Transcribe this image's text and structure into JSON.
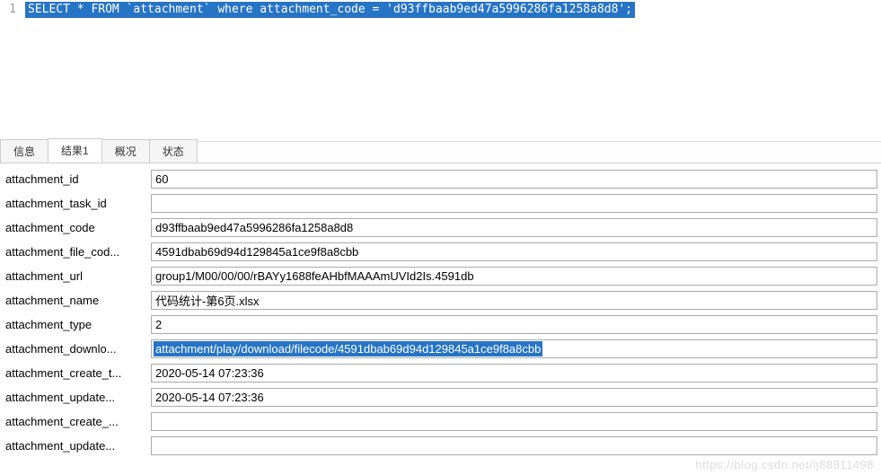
{
  "editor": {
    "line_number": "1",
    "sql": "SELECT * FROM `attachment` where attachment_code = 'd93ffbaab9ed47a5996286fa1258a8d8';"
  },
  "tabs": {
    "items": [
      {
        "label": "信息"
      },
      {
        "label": "结果1"
      },
      {
        "label": "概况"
      },
      {
        "label": "状态"
      }
    ],
    "active_index": 1
  },
  "rows": [
    {
      "label": "attachment_id",
      "value": "60",
      "selected": false
    },
    {
      "label": "attachment_task_id",
      "value": "",
      "selected": false
    },
    {
      "label": "attachment_code",
      "value": "d93ffbaab9ed47a5996286fa1258a8d8",
      "selected": false
    },
    {
      "label": "attachment_file_cod...",
      "value": "4591dbab69d94d129845a1ce9f8a8cbb",
      "selected": false
    },
    {
      "label": "attachment_url",
      "value": "group1/M00/00/00/rBAYy1688feAHbfMAAAmUVId2Is.4591db",
      "selected": false
    },
    {
      "label": "attachment_name",
      "value": "代码统计-第6页.xlsx",
      "selected": false
    },
    {
      "label": "attachment_type",
      "value": "2",
      "selected": false
    },
    {
      "label": "attachment_downlo...",
      "value": "attachment/play/download/filecode/4591dbab69d94d129845a1ce9f8a8cbb",
      "selected": true
    },
    {
      "label": "attachment_create_t...",
      "value": "2020-05-14 07:23:36",
      "selected": false
    },
    {
      "label": "attachment_update...",
      "value": "2020-05-14 07:23:36",
      "selected": false
    },
    {
      "label": "attachment_create_...",
      "value": "",
      "selected": false
    },
    {
      "label": "attachment_update...",
      "value": "",
      "selected": false
    }
  ],
  "watermark": "https://blog.csdn.net/lj88811498"
}
